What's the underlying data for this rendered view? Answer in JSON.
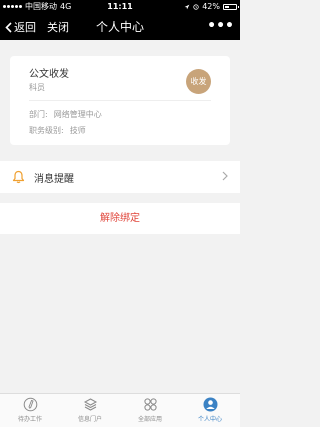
{
  "status_bar": {
    "carrier": "中国移动",
    "network": "4G",
    "time": "11:11",
    "battery": "42%"
  },
  "nav": {
    "back_label": "返回",
    "close_label": "关闭",
    "title": "个人中心",
    "more_label": "•••"
  },
  "profile": {
    "name": "公文收发",
    "role": "科员",
    "avatar_text": "收发",
    "department_label": "部门:",
    "department_value": "网络管理中心",
    "rank_label": "职务级别:",
    "rank_value": "技师"
  },
  "notification": {
    "label": "消息提醒"
  },
  "unbind_label": "解除绑定",
  "tabs": [
    {
      "label": "待办工作",
      "icon": "pen-circle-icon",
      "active": false
    },
    {
      "label": "信息门户",
      "icon": "layers-icon",
      "active": false
    },
    {
      "label": "全部应用",
      "icon": "grid-circles-icon",
      "active": false
    },
    {
      "label": "个人中心",
      "icon": "user-icon",
      "active": true
    }
  ],
  "colors": {
    "accent": "#3b82c4",
    "avatar": "#c8a47a",
    "danger": "#e0453a",
    "bell": "#f0a030"
  }
}
